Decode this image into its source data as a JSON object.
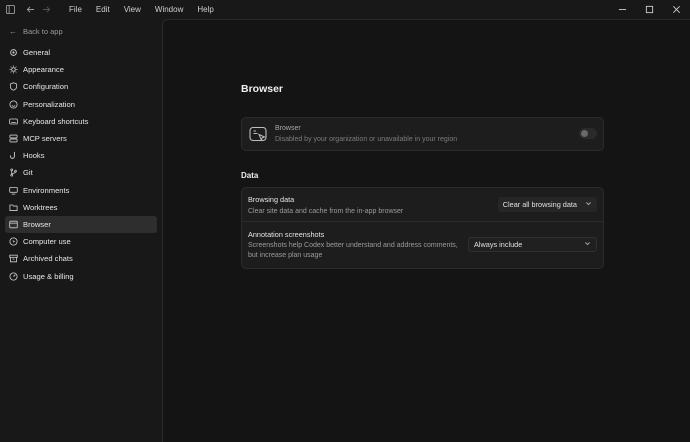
{
  "titlebar": {
    "menu": [
      "File",
      "Edit",
      "View",
      "Window",
      "Help"
    ]
  },
  "sidebar": {
    "back_label": "Back to app",
    "items": [
      {
        "label": "General",
        "icon": "gear-icon"
      },
      {
        "label": "Appearance",
        "icon": "sun-icon"
      },
      {
        "label": "Configuration",
        "icon": "shield-icon"
      },
      {
        "label": "Personalization",
        "icon": "smile-icon"
      },
      {
        "label": "Keyboard shortcuts",
        "icon": "keyboard-icon"
      },
      {
        "label": "MCP servers",
        "icon": "server-icon"
      },
      {
        "label": "Hooks",
        "icon": "hook-icon"
      },
      {
        "label": "Git",
        "icon": "branch-icon"
      },
      {
        "label": "Environments",
        "icon": "monitor-icon"
      },
      {
        "label": "Worktrees",
        "icon": "folder-icon"
      },
      {
        "label": "Browser",
        "icon": "browser-icon",
        "active": true
      },
      {
        "label": "Computer use",
        "icon": "cursor-icon"
      },
      {
        "label": "Archived chats",
        "icon": "archive-icon"
      },
      {
        "label": "Usage & billing",
        "icon": "gauge-icon"
      }
    ]
  },
  "main": {
    "title": "Browser",
    "browser_card": {
      "title": "Browser",
      "description": "Disabled by your organization or unavailable in your region",
      "toggle_on": false
    },
    "data_section": {
      "label": "Data",
      "browsing_data": {
        "title": "Browsing data",
        "description": "Clear site data and cache from the in-app browser",
        "button_label": "Clear all browsing data"
      },
      "annotation": {
        "title": "Annotation screenshots",
        "description": "Screenshots help Codex better understand and address comments, but increase plan usage",
        "selected": "Always include"
      }
    }
  },
  "colors": {
    "background": "#181818",
    "main_background": "#141414",
    "card": "#1d1d1d",
    "active_nav": "#2e2e2e"
  }
}
